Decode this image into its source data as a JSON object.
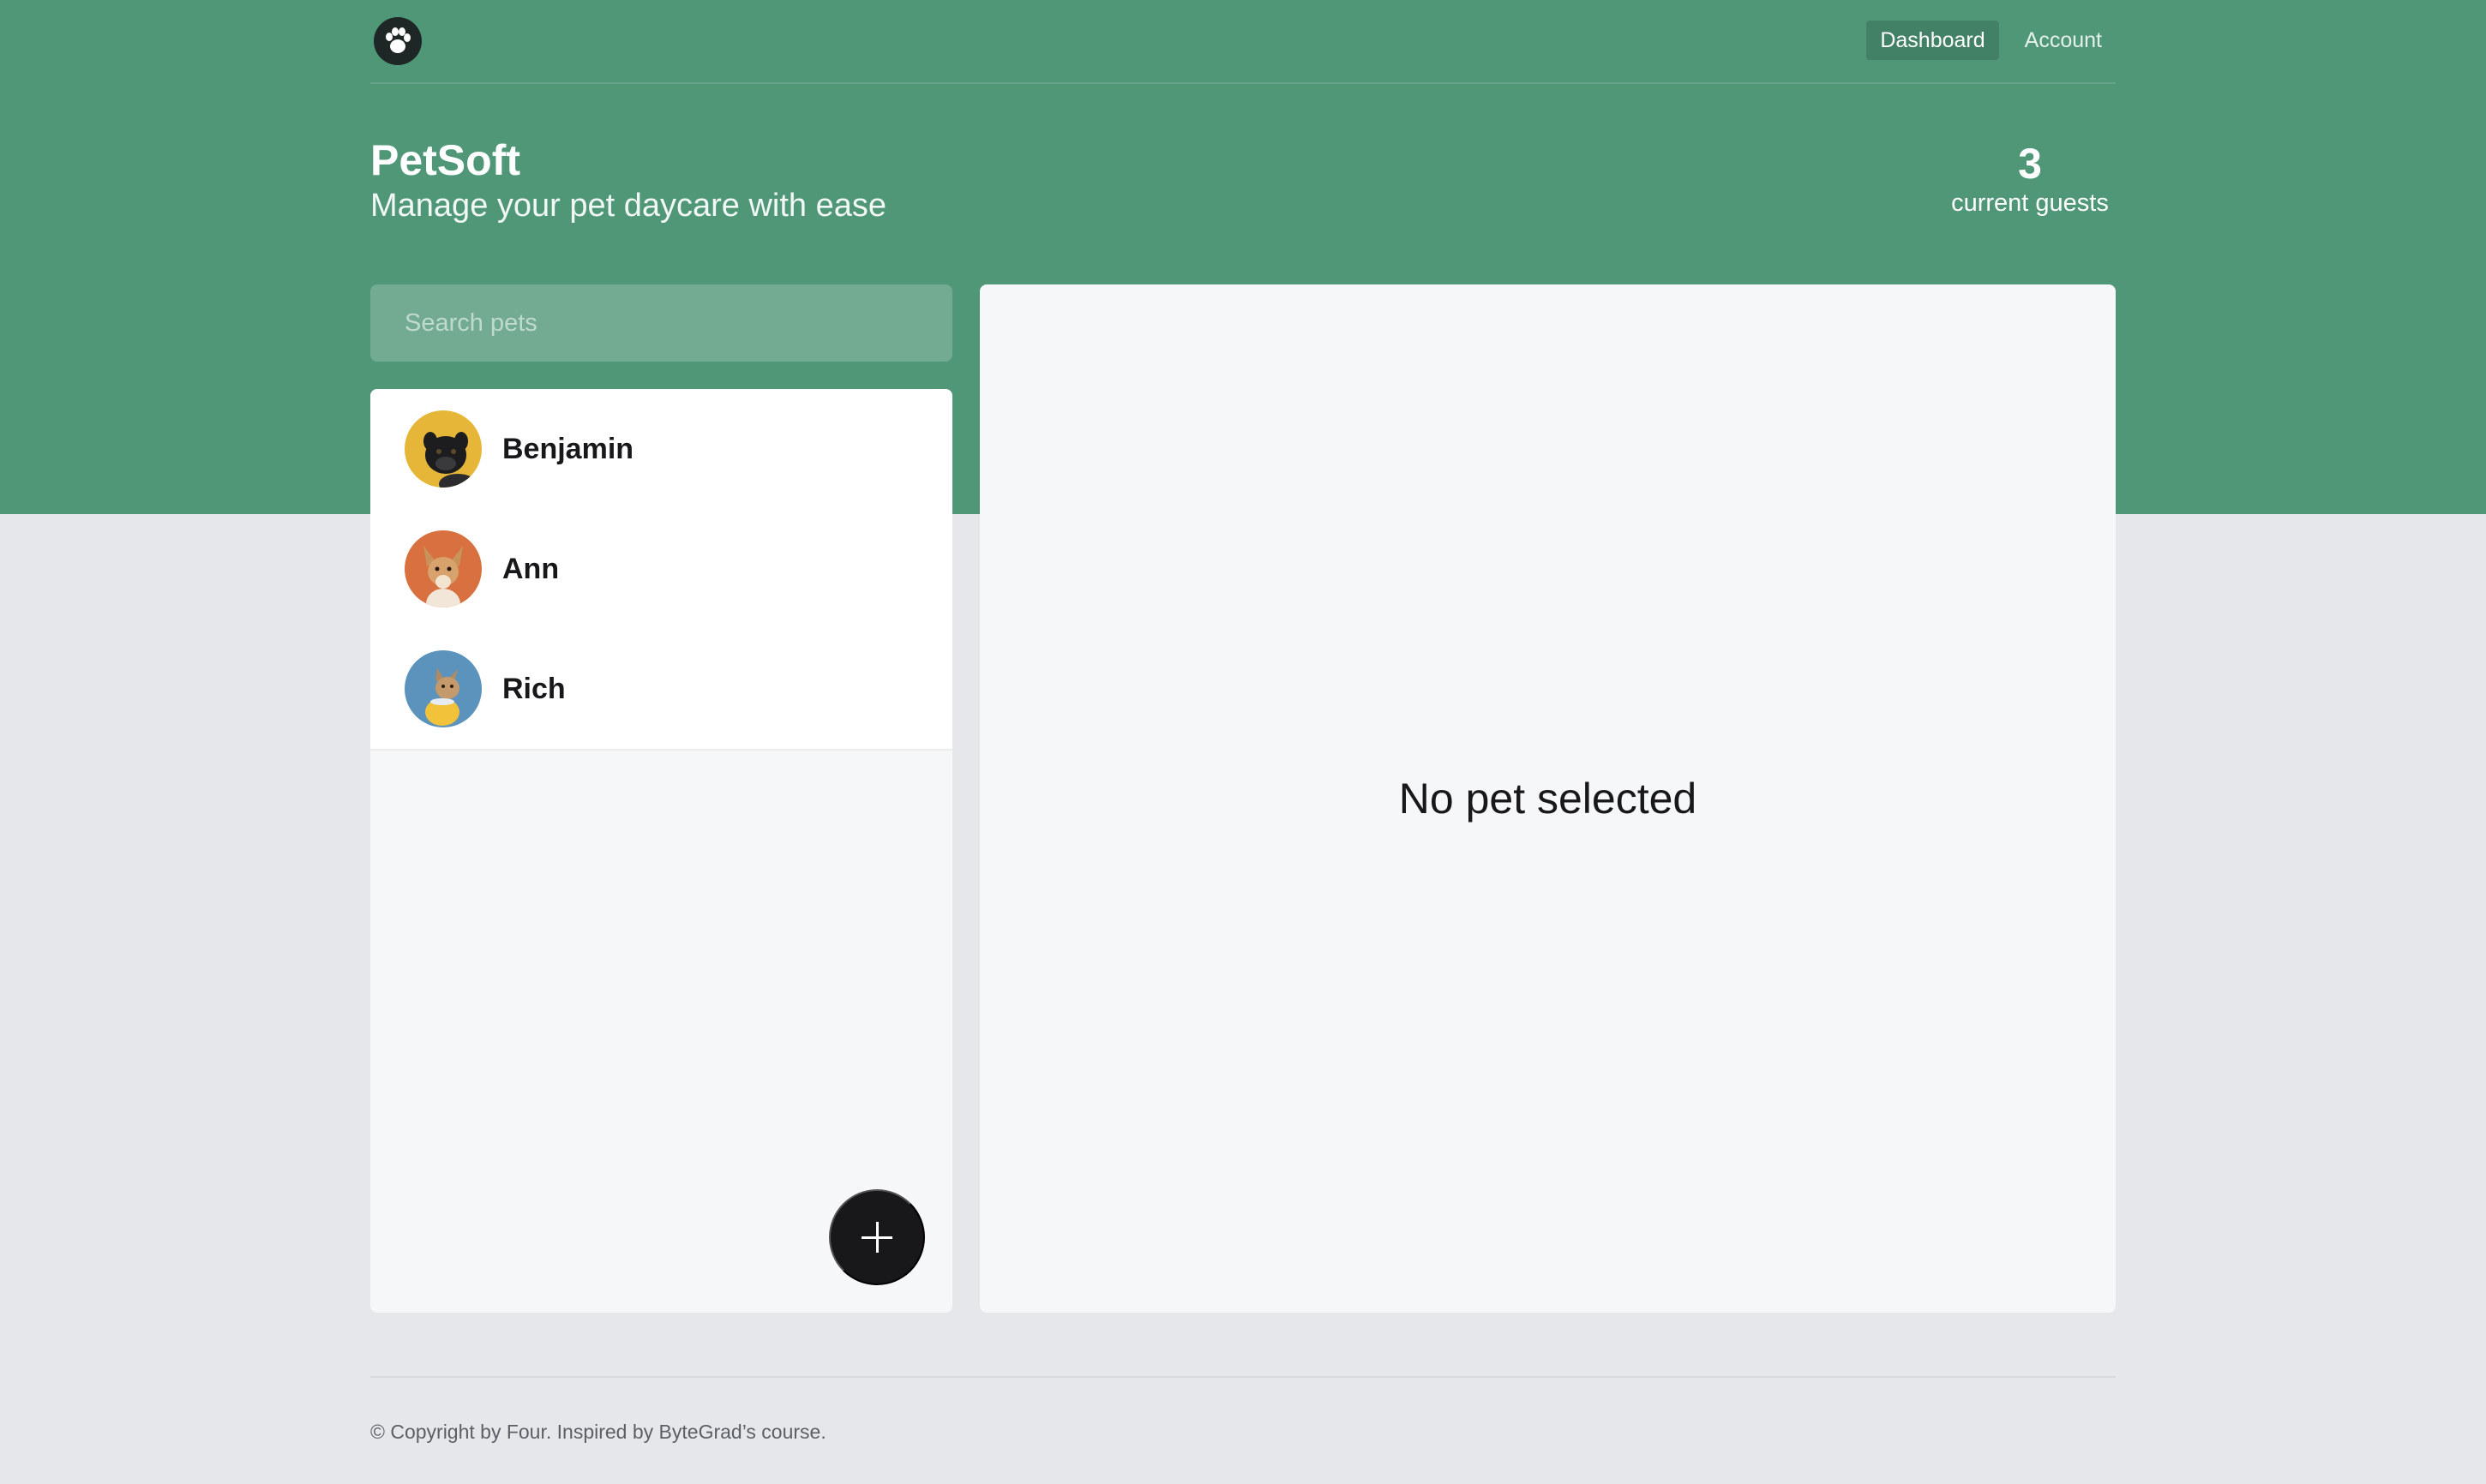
{
  "header": {
    "logo_icon": "paw-icon",
    "nav": [
      {
        "label": "Dashboard",
        "active": true
      },
      {
        "label": "Account",
        "active": false
      }
    ]
  },
  "branding": {
    "title": "PetSoft",
    "subtitle": "Manage your pet daycare with ease"
  },
  "stats": {
    "count": "3",
    "label": "current guests"
  },
  "search": {
    "placeholder": "Search pets",
    "value": ""
  },
  "pets": [
    {
      "name": "Benjamin",
      "avatar_bg": "#e5b637"
    },
    {
      "name": "Ann",
      "avatar_bg": "#d9703f"
    },
    {
      "name": "Rich",
      "avatar_bg": "#5b93bd"
    }
  ],
  "add_button": {
    "icon": "plus-icon"
  },
  "detail": {
    "empty_message": "No pet selected"
  },
  "footer": {
    "text": "© Copyright by Four. Inspired by ByteGrad’s course."
  },
  "colors": {
    "brand_green": "#4f9777",
    "background": "#e6e7ea",
    "dark": "#18181b"
  }
}
